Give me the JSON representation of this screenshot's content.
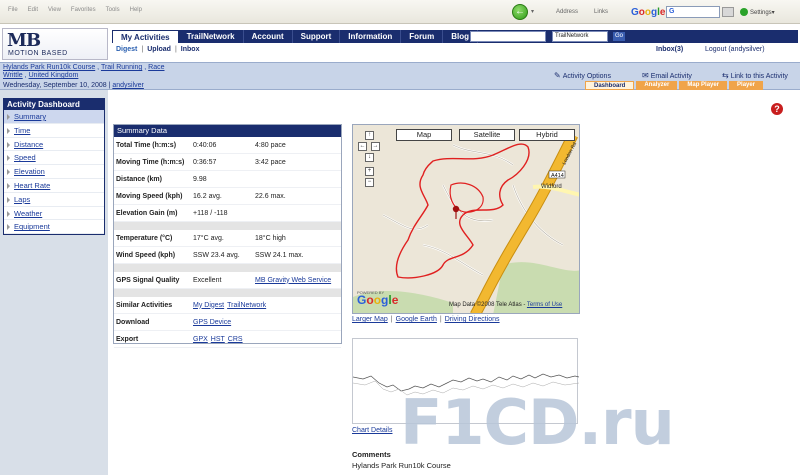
{
  "browser": {
    "menu": [
      "File",
      "Edit",
      "View",
      "Favorites",
      "Tools",
      "Help"
    ],
    "address_label": "Address",
    "links_label": "Links",
    "google_letters": [
      "G",
      "o",
      "o",
      "g",
      "l",
      "e"
    ],
    "search_prefix": "G",
    "settings_label": "Settings▾"
  },
  "site": {
    "logo_mark": "MB",
    "logo_name": "MOTION BASED",
    "nav_tabs": [
      "My Activities",
      "TrailNetwork",
      "Account",
      "Support",
      "Information",
      "Forum",
      "Blog"
    ],
    "search_select": "TrailNetwork",
    "search_go": "Go",
    "subnav": [
      "Digest",
      "Upload",
      "Inbox"
    ],
    "inbox": "Inbox(3)",
    "logout": "Logout (andysilver)"
  },
  "activity": {
    "line1": [
      "Hylands Park Run10k Course",
      "Trail Running",
      "Race"
    ],
    "line2": [
      "Writtle",
      "United Kingdom"
    ],
    "date": "Wednesday, September 10, 2008",
    "user": "andysilver",
    "options": [
      "Activity Options",
      "Email Activity",
      "Link to this Activity"
    ],
    "view_tabs": [
      "Dashboard",
      "Analyzer",
      "Map Player",
      "Player"
    ]
  },
  "sidebar": {
    "title": "Activity Dashboard",
    "items": [
      "Summary",
      "Time",
      "Distance",
      "Speed",
      "Elevation",
      "Heart Rate",
      "Laps",
      "Weather",
      "Equipment"
    ]
  },
  "summary": {
    "title": "Summary Data",
    "total_time": {
      "label": "Total Time (h:m:s)",
      "v1": "0:40:06",
      "v2": "4:80 pace"
    },
    "moving_time": {
      "label": "Moving Time (h:m:s)",
      "v1": "0:36:57",
      "v2": "3:42 pace"
    },
    "distance": {
      "label": "Distance (km)",
      "v1": "9.98"
    },
    "moving_speed": {
      "label": "Moving Speed (kph)",
      "v1": "16.2 avg.",
      "v2": "22.6 max."
    },
    "elevation": {
      "label": "Elevation Gain (m)",
      "v1": "+118 / -118"
    },
    "temperature": {
      "label": "Temperature (°C)",
      "v1": "17°C avg.",
      "v2": "18°C high"
    },
    "wind": {
      "label": "Wind Speed (kph)",
      "v1": "SSW   23.4 avg.",
      "v2": "SSW   24.1 max."
    },
    "gps": {
      "label": "GPS Signal Quality",
      "v1": "Excellent",
      "v2": "MB Gravity Web Service"
    },
    "similar": {
      "label": "Similar Activities",
      "links": [
        "My Digest",
        "TrailNetwork"
      ]
    },
    "download": {
      "label": "Download",
      "links": [
        "GPS Device"
      ]
    },
    "export": {
      "label": "Export",
      "links": [
        "GPX",
        "HST",
        "CRS"
      ]
    }
  },
  "map": {
    "buttons": [
      "Map",
      "Satellite",
      "Hybrid"
    ],
    "road_label": "A414",
    "road_label2": "London Rd",
    "place_label": "Widford",
    "powered_by": "POWERED BY",
    "copyright": "Map Data ©2008 Tele Atlas -",
    "terms": "Terms of Use",
    "links": [
      "Larger Map",
      "Google Earth",
      "Driving Directions"
    ],
    "controls": {
      "up": "↑",
      "left": "←",
      "right": "→",
      "down": "↓",
      "zoom_in": "+",
      "zoom_out": "−"
    }
  },
  "chart": {
    "details_link": "Chart Details"
  },
  "comments": {
    "heading": "Comments",
    "text": "Hylands Park Run10k Course"
  },
  "watermark": "F1CD.ru",
  "colors": {
    "navy": "#1a2d6e",
    "route_red": "#e02020",
    "road_yellow": "#f2b830",
    "tab_orange": "#f0a44a"
  }
}
